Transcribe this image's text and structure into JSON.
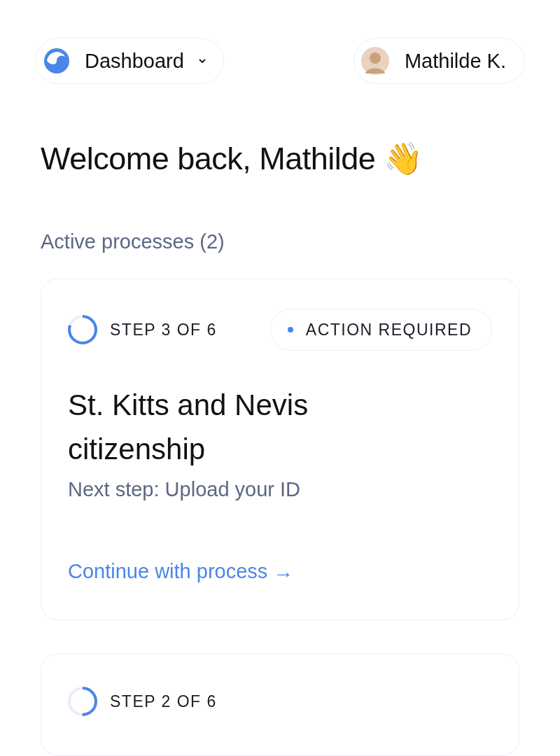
{
  "header": {
    "menu": {
      "label": "Dashboard"
    },
    "user": {
      "name": "Mathilde K."
    }
  },
  "greeting": "Welcome back, Mathilde 👋",
  "section_title": "Active processes (2)",
  "processes": [
    {
      "step": "STEP 3 OF 6",
      "level": 0.8,
      "status": "ACTION REQUIRED",
      "title": "St. Kitts and Nevis citizenship",
      "next_step": "Next step: Upload your ID",
      "link": "Continue with process →"
    },
    {
      "step": "STEP 2 OF 6",
      "level": 0.5
    }
  ]
}
